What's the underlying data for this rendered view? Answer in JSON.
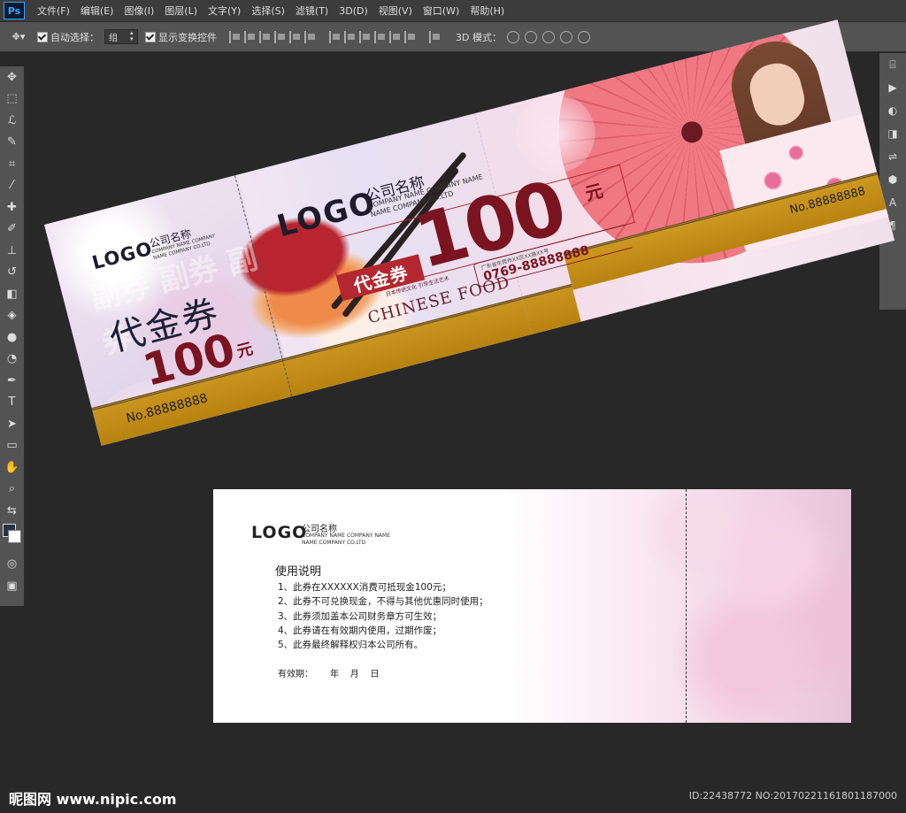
{
  "app": {
    "logo": "Ps"
  },
  "menu": [
    "文件(F)",
    "编辑(E)",
    "图像(I)",
    "图层(L)",
    "文字(Y)",
    "选择(S)",
    "滤镜(T)",
    "3D(D)",
    "视图(V)",
    "窗口(W)",
    "帮助(H)"
  ],
  "options": {
    "auto_select_label": "自动选择：",
    "auto_select_value": "组",
    "show_transform_label": "显示变换控件",
    "mode3d_label": "3D 模式："
  },
  "front": {
    "stub": {
      "logo": "LOGO",
      "company": "公司名称",
      "company_en1": "COMPANY NAME COMPANY",
      "company_en2": "NAME COMPANY CO.LTD",
      "title": "代金券",
      "amount": "100",
      "unit": "元",
      "watermark": "副券 副券 副券",
      "no": "No.88888888"
    },
    "logo": "LOGO",
    "company": "公司名称",
    "company_en1": "COMPANY NAME COMPANY NAME",
    "company_en2": "NAME COMPANY CO.LTD",
    "badge": "代金券",
    "amount": "100",
    "unit": "元",
    "address": "广东省东莞市XX区XX路XX号",
    "phone": "0769-88888888",
    "culture": "日本传统文化 引导生活艺术",
    "food": "CHINESE FOOD",
    "no": "No.88888888"
  },
  "back": {
    "logo": "LOGO",
    "company": "公司名称",
    "company_en1": "COMPANY NAME COMPANY NAME",
    "company_en2": "NAME COMPANY CO.LTD",
    "title": "使用说明",
    "rules": [
      "1、此券在XXXXXX消费可抵现金100元；",
      "2、此券不可兑换现金，不得与其他优惠同时使用；",
      "3、此券须加盖本公司财务章方可生效；",
      "4、此券请在有效期内使用，过期作废；",
      "5、此券最终解释权归本公司所有。"
    ],
    "valid": "有效期：      年    月    日"
  },
  "watermark": {
    "left": "昵图网 www.nipic.com",
    "right": "ID:22438772 NO:20170221161801187000"
  }
}
